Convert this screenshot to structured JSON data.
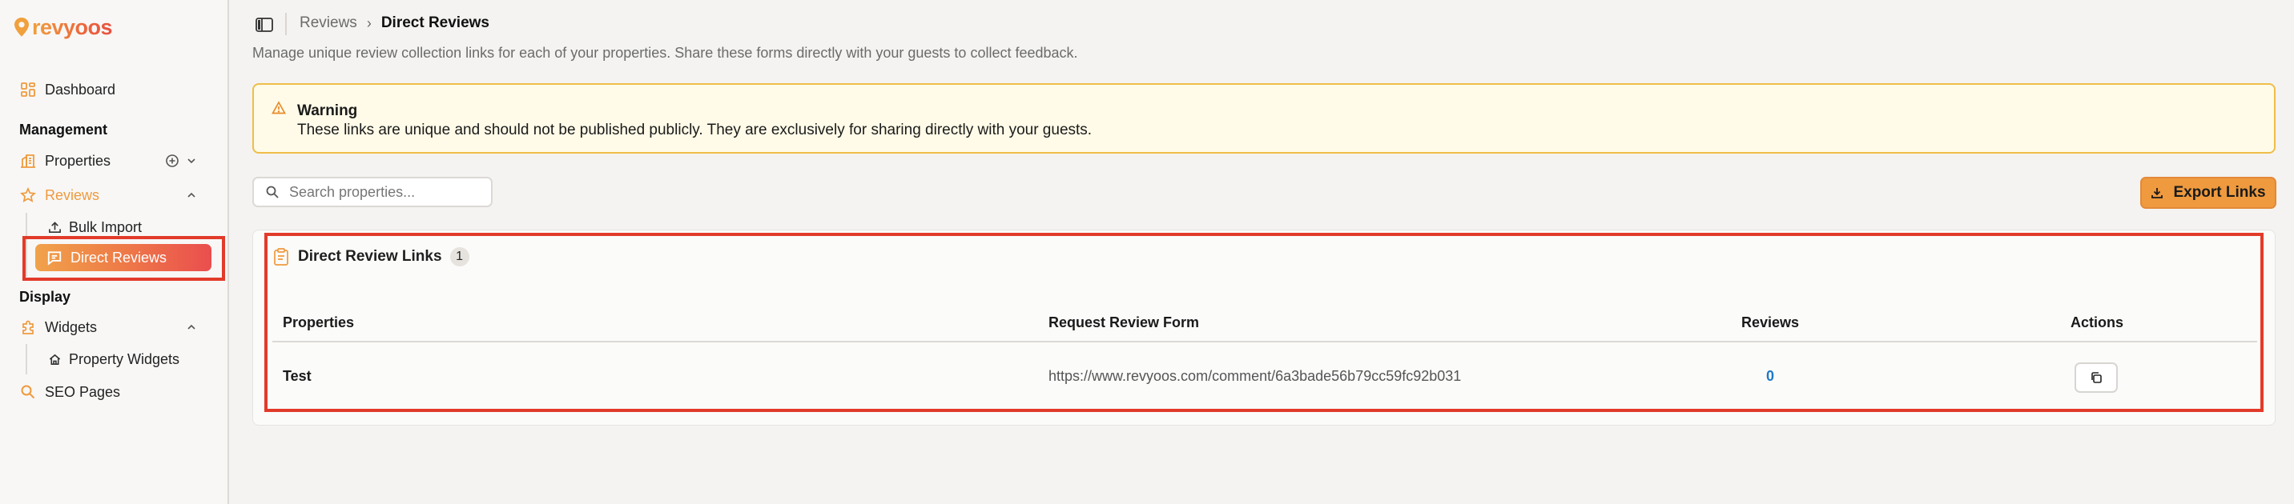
{
  "brand": {
    "name": "revyoos"
  },
  "sidebar": {
    "dashboard_label": "Dashboard",
    "management_label": "Management",
    "properties_label": "Properties",
    "reviews_label": "Reviews",
    "bulk_import_label": "Bulk Import",
    "direct_reviews_label": "Direct Reviews",
    "display_label": "Display",
    "widgets_label": "Widgets",
    "property_widgets_label": "Property Widgets",
    "seo_pages_label": "SEO Pages"
  },
  "header": {
    "breadcrumb_parent": "Reviews",
    "breadcrumb_separator": "›",
    "breadcrumb_current": "Direct Reviews",
    "subtitle": "Manage unique review collection links for each of your properties. Share these forms directly with your guests to collect feedback."
  },
  "warning": {
    "title": "Warning",
    "text": "These links are unique and should not be published publicly. They are exclusively for sharing directly with your guests."
  },
  "search": {
    "placeholder": "Search properties...",
    "value": ""
  },
  "export_button_label": "Export Links",
  "table": {
    "title": "Direct Review Links",
    "count": "1",
    "columns": [
      "Properties",
      "Request Review Form",
      "Reviews",
      "Actions"
    ],
    "rows": [
      {
        "property": "Test",
        "form_url": "https://www.revyoos.com/comment/6a3bade56b79cc59fc92b031",
        "reviews": "0"
      }
    ]
  },
  "colors": {
    "accent": "#ef9a3e",
    "active_gradient_start": "#f0a24a",
    "active_gradient_end": "#ea4e4e",
    "warning_bg": "#fffbe8",
    "warning_border": "#f0bd48",
    "highlight": "#e23b2a",
    "link_count": "#1f78c8"
  }
}
